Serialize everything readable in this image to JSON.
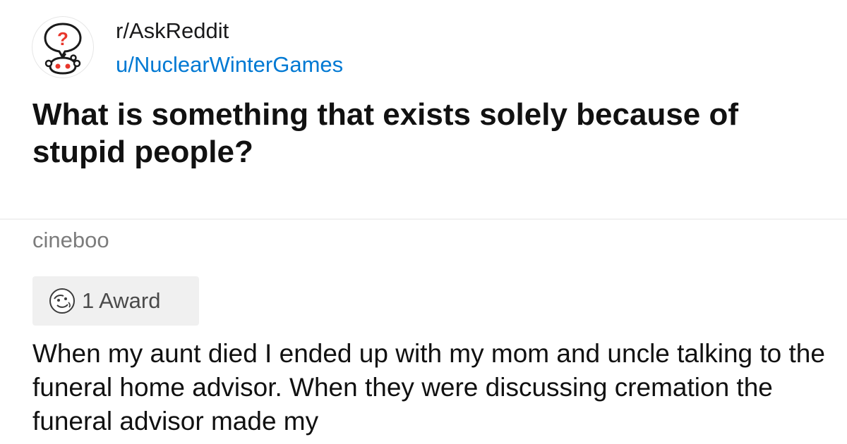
{
  "post": {
    "subreddit": "r/AskReddit",
    "username": "u/NuclearWinterGames",
    "title": "What is something that exists solely because of stupid people?",
    "avatar_icon": "askreddit-snoo-icon",
    "avatar_glyph": "?"
  },
  "comment": {
    "author": "cineboo",
    "award_icon": "award-face-icon",
    "award_label": "1 Award",
    "body": "When my aunt died I ended up with my mom and uncle talking to the funeral home advisor. When they were discussing cremation the funeral advisor made my"
  },
  "colors": {
    "link_blue": "#0079d3",
    "question_red": "#e8362b",
    "muted_gray": "#7c7c7c",
    "pill_bg": "#f0f0f0"
  }
}
